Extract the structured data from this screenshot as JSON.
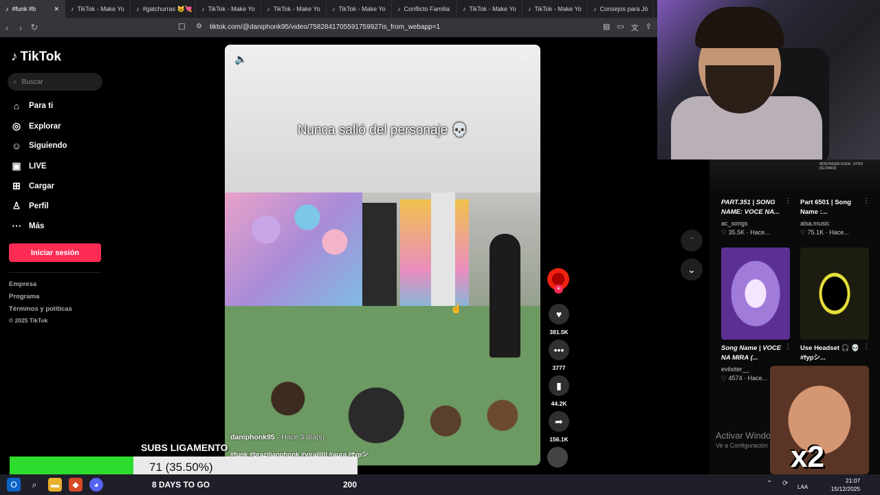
{
  "browser": {
    "tabs": [
      {
        "label": "#funk #b",
        "active": true
      },
      {
        "label": "TikTok - Make Yo"
      },
      {
        "label": "#gatchurras 😺💘"
      },
      {
        "label": "TikTok - Make Yo"
      },
      {
        "label": "TikTok - Make Yo"
      },
      {
        "label": "TikTok - Make Yo"
      },
      {
        "label": "Conflicto Familia"
      },
      {
        "label": "TikTok - Make Yo"
      },
      {
        "label": "TikTok - Make Yo"
      },
      {
        "label": "Consejos para Jó"
      }
    ],
    "url": "tiktok.com/@daniphonk95/video/7582841705591759927is_from_webapp=1"
  },
  "sidebar": {
    "logo": "TikTok",
    "search_placeholder": "Buscar",
    "items": [
      {
        "label": "Para ti",
        "icon": "home-icon"
      },
      {
        "label": "Explorar",
        "icon": "compass-icon"
      },
      {
        "label": "Siguiendo",
        "icon": "user-follow-icon"
      },
      {
        "label": "LIVE",
        "icon": "live-icon"
      },
      {
        "label": "Cargar",
        "icon": "upload-icon"
      },
      {
        "label": "Perfil",
        "icon": "profile-icon"
      },
      {
        "label": "Más",
        "icon": "more-icon"
      }
    ],
    "login": "Iniciar sesión",
    "footer": [
      "Empresa",
      "Programa",
      "Términos y políticas",
      "© 2025 TikTok"
    ]
  },
  "video": {
    "caption": "Nunca salió del personaje 💀",
    "author": "daniphonk95",
    "date": "· Hace 3 día(s)",
    "tags": "#funk #brazilianphonk #virallllll #aura #fypシ",
    "likes": "381.5K",
    "comments": "3777",
    "saves": "44.2K",
    "shares": "156.1K"
  },
  "recommendations": [
    {
      "title": "PART.351 | SONG NAME: VOCE NA...",
      "user": "ac_songs",
      "likes": "35.5K",
      "time": "Hace..."
    },
    {
      "title": "Part 6501 | Song Name :...",
      "user": "alsa.music",
      "likes": "75.1K",
      "time": "Hace..."
    },
    {
      "title": "Song Name | VOCE NA MIRA (...",
      "user": "evilxiter__",
      "likes": "4574",
      "time": "Hace..."
    },
    {
      "title": "Use Headset 🎧 💀 #fypシ...",
      "user": "",
      "likes": "",
      "time": ""
    }
  ],
  "rec_top_label": "MONTAGEM GUDA - SYDO [SLOWED]",
  "watermark": {
    "line1": "Activar Window",
    "line2": "Ve a Configuración pa"
  },
  "stream": {
    "subs_label": "SUBS LIGAMENTO",
    "progress_text": "71 (35.50%)",
    "progress_fraction": 0.355,
    "days": "8 DAYS TO GO",
    "goal": "200",
    "multiplier": "x2"
  },
  "taskbar": {
    "lang": "LAA",
    "time": "21:07",
    "date": "15/12/2025"
  },
  "colors": {
    "accent": "#fe2c55",
    "progress": "#2ddc2d"
  }
}
